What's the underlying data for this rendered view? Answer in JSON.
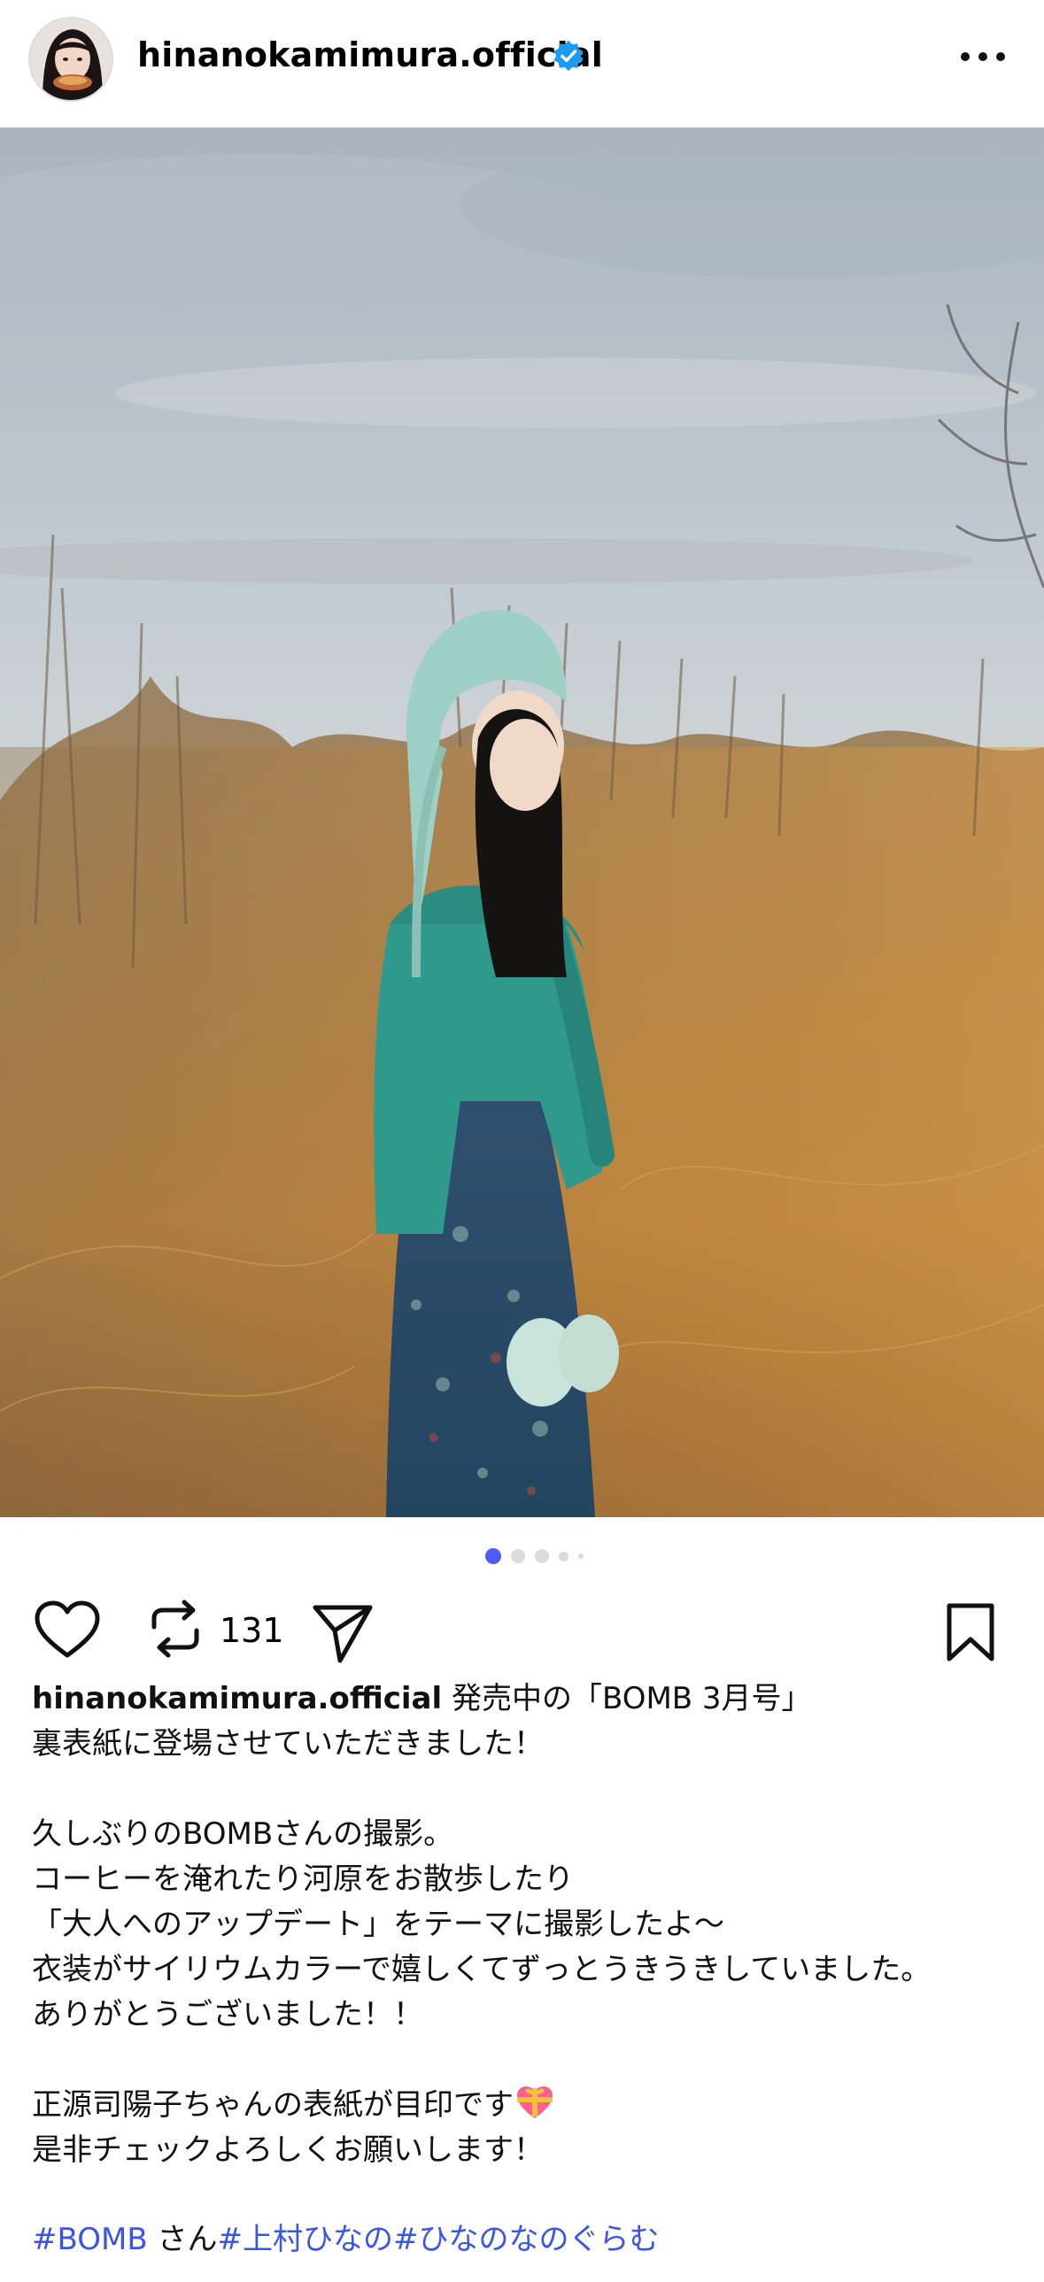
{
  "post": {
    "username": "hinanokamimura.official",
    "verified": true
  },
  "carousel": {
    "count": 5,
    "active_index": 0
  },
  "actions": {
    "like_icon": "heart-icon",
    "repost_icon": "repost-icon",
    "repost_count": "131",
    "share_icon": "send-icon",
    "save_icon": "bookmark-icon"
  },
  "caption": {
    "author": "hinanokamimura.official",
    "lines": [
      " 発売中の「BOMB 3月号」",
      "裏表紙に登場させていただきました！",
      "",
      "久しぶりのBOMBさんの撮影。",
      "コーヒーを淹れたり河原をお散歩したり",
      "「大人へのアップデート」をテーマに撮影したよ〜",
      "衣装がサイリウムカラーで嬉しくてずっとうきうきしていました。",
      "ありがとうございました！！",
      "",
      "正源司陽子ちゃんの表紙が目印です",
      "是非チェックよろしくお願いします！"
    ],
    "tag1": "#BOMB",
    "between": " さん",
    "tag2": "#上村ひなの",
    "tag3": "#ひなのなのぐらむ"
  },
  "colors": {
    "accent_blue": "#4f5bff",
    "hashtag": "#3b55e6",
    "verified": "#1d9bf0"
  }
}
